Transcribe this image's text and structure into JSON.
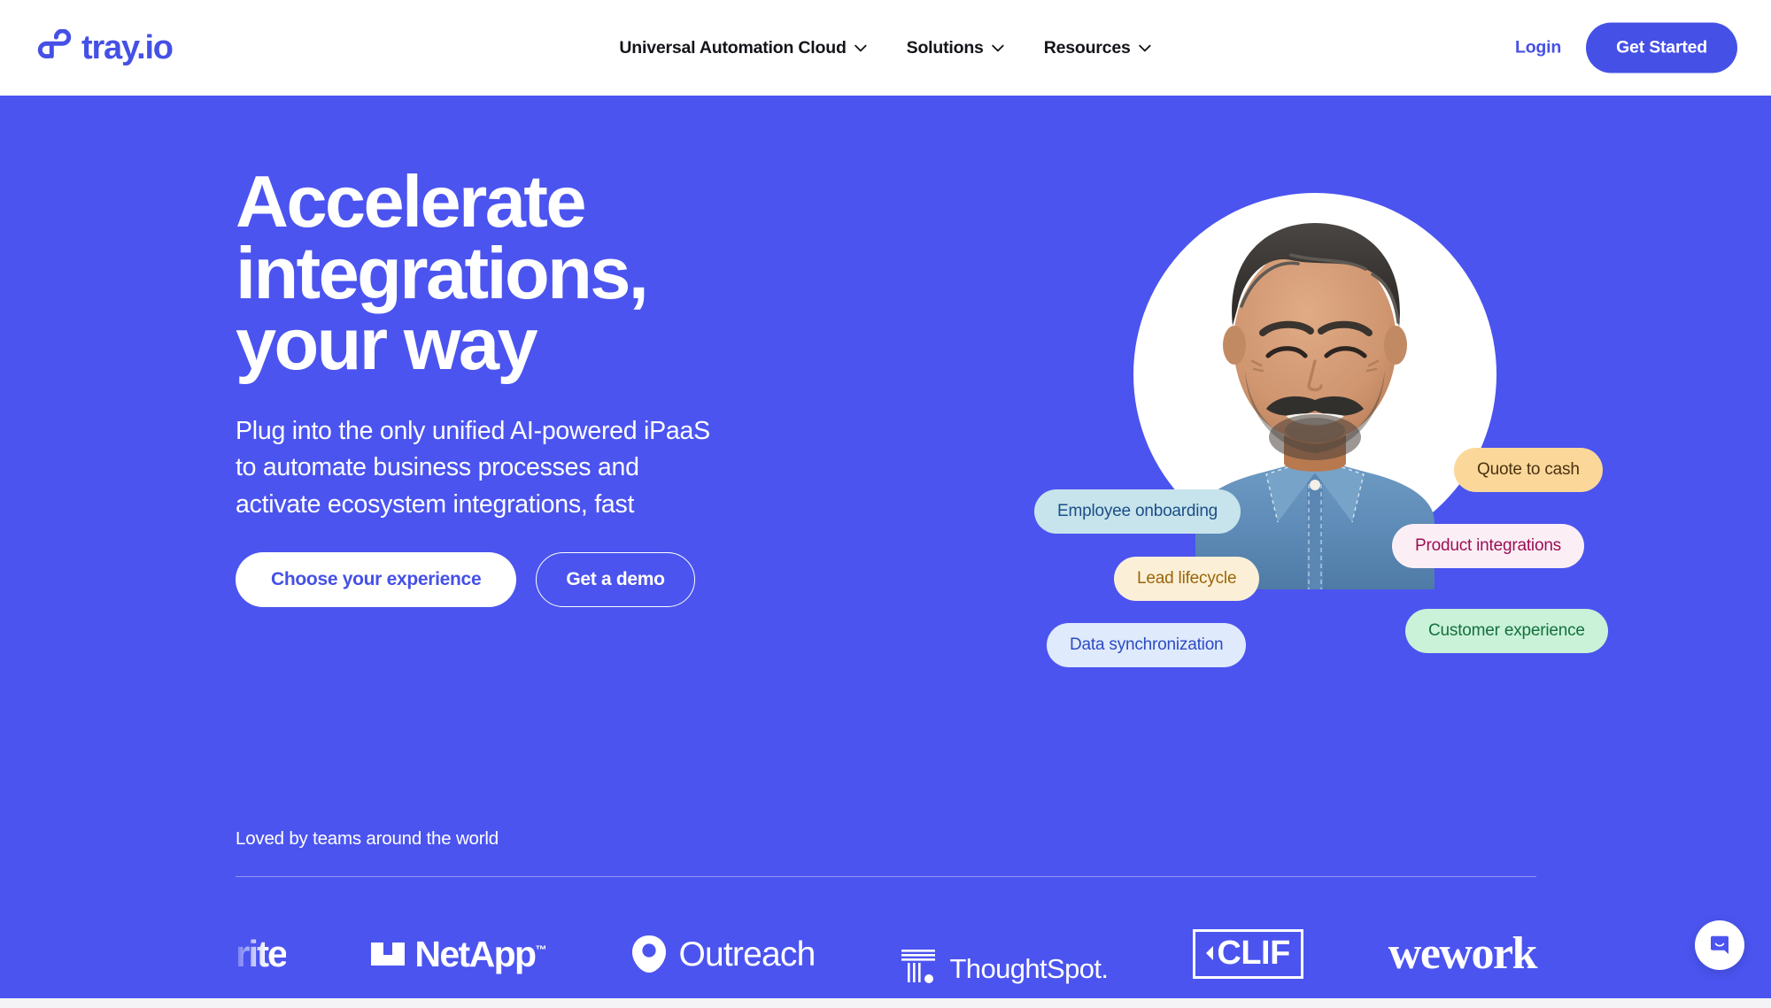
{
  "header": {
    "logo_text": "tray.io",
    "logo_icon": "tray-infinity-logo-icon",
    "nav": [
      {
        "label": "Universal Automation Cloud",
        "icon": "chevron-down-icon"
      },
      {
        "label": "Solutions",
        "icon": "chevron-down-icon"
      },
      {
        "label": "Resources",
        "icon": "chevron-down-icon"
      }
    ],
    "login_label": "Login",
    "get_started_label": "Get Started"
  },
  "hero": {
    "title": "Accelerate\nintegrations,\nyour way",
    "subtitle": "Plug into the only unified AI-powered iPaaS\nto automate business processes and\nactivate ecosystem integrations, fast",
    "primary_cta": "Choose your experience",
    "secondary_cta": "Get a demo",
    "background_color": "#4b54ef",
    "accent_color": "#4550e6"
  },
  "portrait": {
    "alt": "smiling man in denim shirt",
    "pills": [
      {
        "label": "Employee onboarding",
        "bg": "#c7e4ec",
        "fg": "#1c4e87"
      },
      {
        "label": "Lead lifecycle",
        "bg": "#fbf0d7",
        "fg": "#9a6508"
      },
      {
        "label": "Data synchronization",
        "bg": "#dfeafc",
        "fg": "#2c4bc4"
      },
      {
        "label": "Quote to cash",
        "bg": "#fbd89a",
        "fg": "#4a3210"
      },
      {
        "label": "Product integrations",
        "bg": "#fbeff5",
        "fg": "#9c0f55"
      },
      {
        "label": "Customer experience",
        "bg": "#c9f2d9",
        "fg": "#14703c"
      }
    ]
  },
  "social_proof": {
    "heading": "Loved by teams around the world",
    "logos": [
      {
        "name": "rite",
        "text": "rite"
      },
      {
        "name": "netapp",
        "text": "NetApp",
        "tm": "™"
      },
      {
        "name": "outreach",
        "text": "Outreach"
      },
      {
        "name": "thoughtspot",
        "text": "ThoughtSpot."
      },
      {
        "name": "clif",
        "text": "CLIF"
      },
      {
        "name": "wework",
        "text": "wework"
      }
    ]
  },
  "chat": {
    "icon": "chat-bubble-smile-icon",
    "label": "Open chat"
  }
}
